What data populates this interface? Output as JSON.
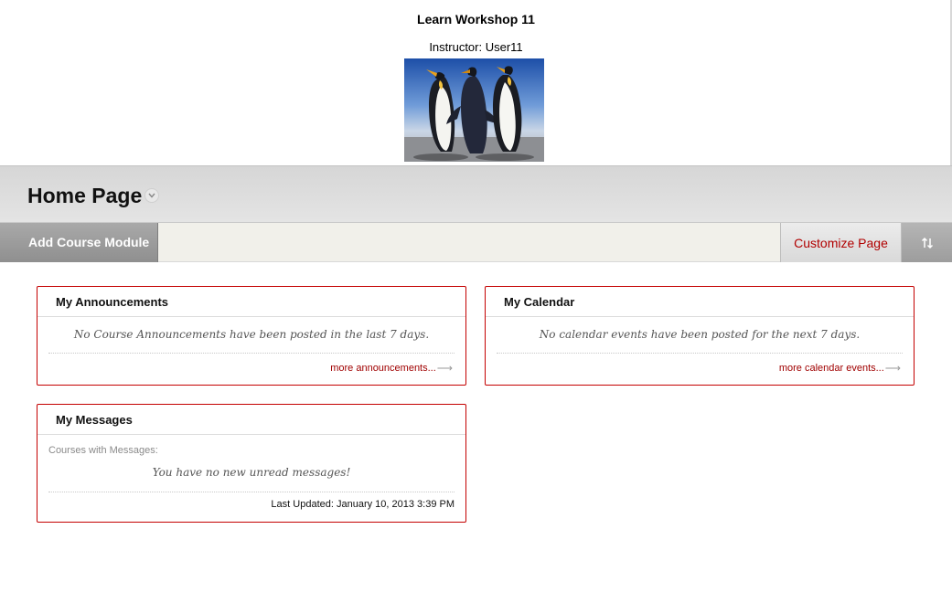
{
  "banner": {
    "course_title": "Learn Workshop 11",
    "instructor": "Instructor: User11",
    "image_description": "penguins-banner-image"
  },
  "page": {
    "title": "Home Page"
  },
  "action_bar": {
    "add_module_label": "Add Course Module",
    "customize_label": "Customize Page",
    "reorder_icon": "reorder-arrows-icon"
  },
  "modules": {
    "announcements": {
      "title": "My Announcements",
      "message": "No Course Announcements have been posted in the last 7 days.",
      "link": "more announcements..."
    },
    "calendar": {
      "title": "My Calendar",
      "message": "No calendar events have been posted for the next 7 days.",
      "link": "more calendar events..."
    },
    "messages": {
      "title": "My Messages",
      "courses_label": "Courses with Messages:",
      "message": "You have no new unread messages!",
      "last_updated": "Last Updated: January 10, 2013 3:39 PM"
    }
  },
  "colors": {
    "accent_red": "#c40000",
    "link_red": "#a00000",
    "action_bar_bg": "#f1f0ea",
    "title_bar_bg": "#d6d6d6"
  }
}
